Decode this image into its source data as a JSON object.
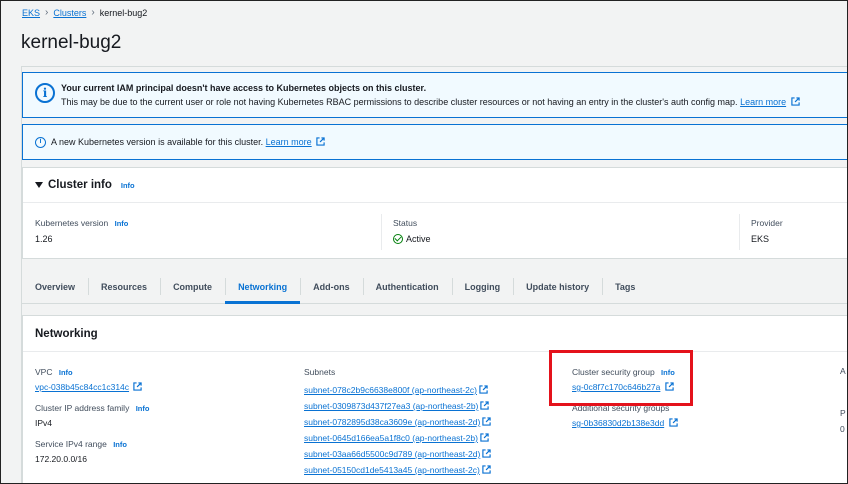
{
  "breadcrumb": {
    "items": [
      "EKS",
      "Clusters"
    ],
    "current": "kernel-bug2"
  },
  "page_title": "kernel-bug2",
  "alert_iam": {
    "title": "Your current IAM principal doesn't have access to Kubernetes objects on this cluster.",
    "body": "This may be due to the current user or role not having Kubernetes RBAC permissions to describe cluster resources or not having an entry in the cluster's auth config map.",
    "link": "Learn more"
  },
  "alert_k8s": {
    "body": "A new Kubernetes version is available for this cluster.",
    "link": "Learn more"
  },
  "cluster_info": {
    "title": "Cluster info",
    "info": "Info",
    "k8s_version_label": "Kubernetes version",
    "k8s_version_info": "Info",
    "k8s_version": "1.26",
    "status_label": "Status",
    "status": "Active",
    "provider_label": "Provider",
    "provider": "EKS"
  },
  "tabs": [
    "Overview",
    "Resources",
    "Compute",
    "Networking",
    "Add-ons",
    "Authentication",
    "Logging",
    "Update history",
    "Tags"
  ],
  "active_tab": "Networking",
  "networking": {
    "title": "Networking",
    "vpc_label": "VPC",
    "vpc_info": "Info",
    "vpc": "vpc-038b45c84cc1c314c",
    "ip_family_label": "Cluster IP address family",
    "ip_family_info": "Info",
    "ip_family": "IPv4",
    "ipv4_range_label": "Service IPv4 range",
    "ipv4_range_info": "Info",
    "ipv4_range": "172.20.0.0/16",
    "subnets_label": "Subnets",
    "subnets": [
      "subnet-078c2b9c6638e800f (ap-northeast-2c)",
      "subnet-0309873d437f27ea3 (ap-northeast-2b)",
      "subnet-0782895d38ca3609e (ap-northeast-2d)",
      "subnet-0645d166ea5a1f8c0 (ap-northeast-2b)",
      "subnet-03aa66d5500c9d789 (ap-northeast-2d)",
      "subnet-05150cd1de5413a45 (ap-northeast-2c)"
    ],
    "csg_label": "Cluster security group",
    "csg_info": "Info",
    "csg": "sg-0c8f7c170c646b27a",
    "asg_label": "Additional security groups",
    "asg": "sg-0b36830d2b138e3dd",
    "clipped_col": [
      "A",
      "P",
      "0"
    ]
  },
  "colors": {
    "accent": "#0972d3",
    "success": "#037f0c",
    "highlight": "#e4121b"
  }
}
